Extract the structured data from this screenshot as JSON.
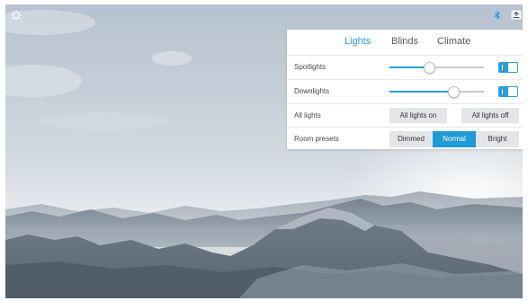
{
  "app": {
    "icons": {
      "settings": "gear-icon",
      "bluetooth": "bluetooth-icon",
      "share": "share-screen-icon"
    }
  },
  "panel": {
    "tabs": [
      {
        "label": "Lights",
        "active": true
      },
      {
        "label": "Blinds",
        "active": false
      },
      {
        "label": "Climate",
        "active": false
      }
    ],
    "rows": {
      "spotlights": {
        "label": "Spotlights",
        "level": 0.42,
        "on": true
      },
      "downlights": {
        "label": "Downlights",
        "level": 0.68,
        "on": true
      },
      "all_lights": {
        "label": "All lights",
        "on_label": "All lights on",
        "off_label": "All lights off"
      },
      "room_presets": {
        "label": "Room presets",
        "options": [
          "Dimmed",
          "Normal",
          "Bright"
        ],
        "selected": "Normal"
      }
    }
  },
  "colors": {
    "accent": "#2a9fd8",
    "selected_preset": "#1f9ad6",
    "button_bg": "#e3e5e8"
  }
}
